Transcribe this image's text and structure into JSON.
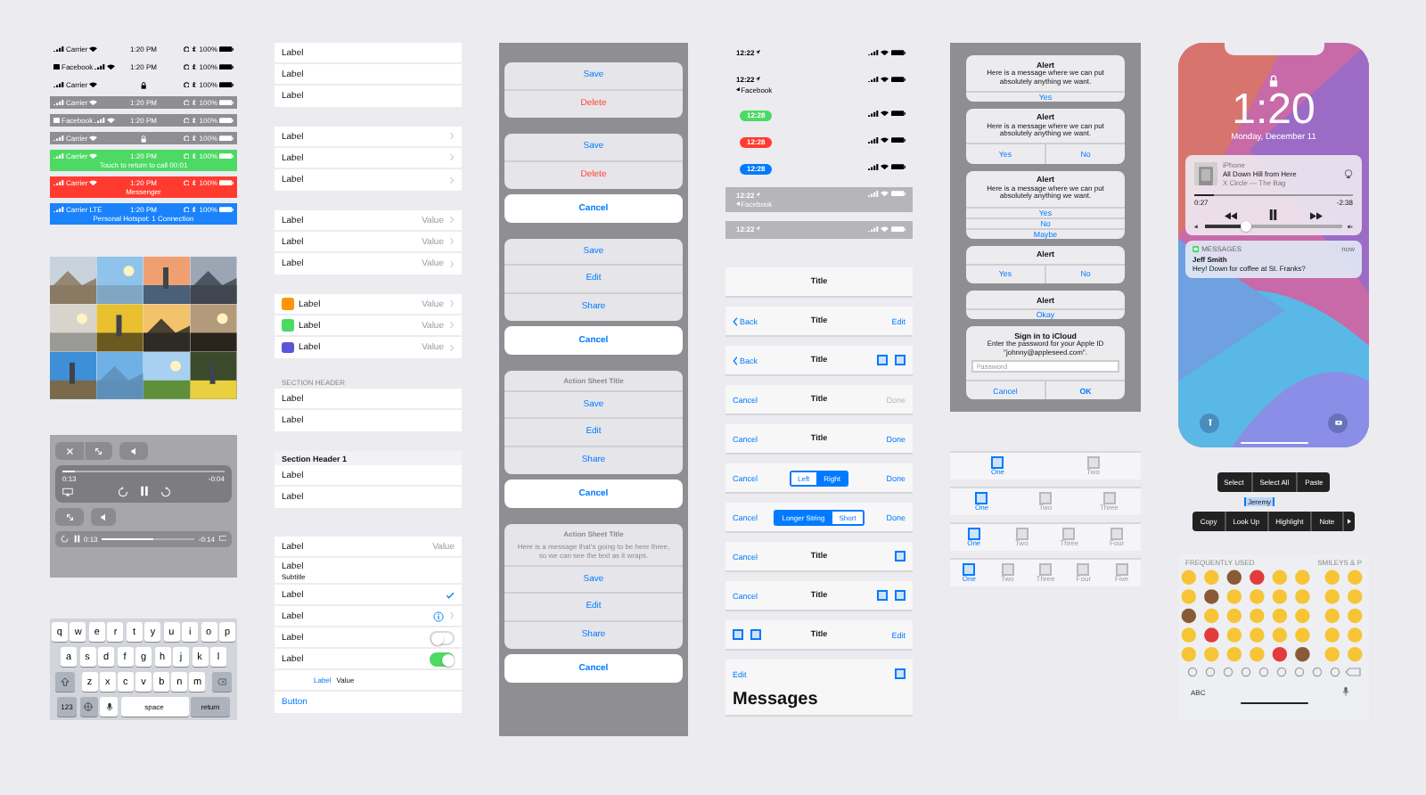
{
  "status_bars": [
    {
      "kind": "plain",
      "carrier": "Carrier",
      "time": "1:20 PM",
      "locked": false,
      "battery": "100%"
    },
    {
      "kind": "plain",
      "back_app": "Facebook",
      "time": "1:20 PM",
      "locked": false,
      "battery": "100%"
    },
    {
      "kind": "plain",
      "carrier": "Carrier",
      "locked": true,
      "battery": "100%"
    },
    {
      "kind": "gray",
      "carrier": "Carrier",
      "time": "1:20 PM",
      "locked": false,
      "battery": "100%"
    },
    {
      "kind": "gray",
      "back_app": "Facebook",
      "time": "1:20 PM",
      "locked": false,
      "battery": "100%"
    },
    {
      "kind": "gray",
      "carrier": "Carrier",
      "locked": true,
      "battery": "100%"
    },
    {
      "kind": "green",
      "carrier": "Carrier",
      "time": "1:20 PM",
      "locked": false,
      "battery": "100%",
      "banner": "Touch to return to call 00:01"
    },
    {
      "kind": "red",
      "carrier": "Carrier",
      "time": "1:20 PM",
      "locked": false,
      "battery": "100%",
      "banner": "Messenger"
    },
    {
      "kind": "blue",
      "carrier": "Carrier",
      "network": "LTE",
      "time": "1:20 PM",
      "locked": false,
      "battery": "100%",
      "banner": "Personal Hotspot: 1 Connection"
    }
  ],
  "video_controls": {
    "scrubber": {
      "elapsed": "0:13",
      "remaining": "-0:04",
      "level": 0.08
    },
    "mini_scrubber": {
      "elapsed": "0:13",
      "remaining": "-0:14",
      "level": 0.55
    }
  },
  "keyboard": {
    "rows": [
      [
        "q",
        "w",
        "e",
        "r",
        "t",
        "y",
        "u",
        "i",
        "o",
        "p"
      ],
      [
        "a",
        "s",
        "d",
        "f",
        "g",
        "h",
        "j",
        "k",
        "l"
      ],
      [
        "z",
        "x",
        "c",
        "v",
        "b",
        "n",
        "m"
      ]
    ],
    "numbers_key": "123",
    "space_key": "space",
    "return_key": "return"
  },
  "table_groups": [
    {
      "rows": [
        {
          "kind": "basic",
          "label": "Label"
        },
        {
          "kind": "basic",
          "label": "Label"
        },
        {
          "kind": "basic",
          "label": "Label"
        }
      ]
    },
    {
      "rows": [
        {
          "kind": "disclosure",
          "label": "Label"
        },
        {
          "kind": "disclosure",
          "label": "Label"
        },
        {
          "kind": "disclosure",
          "label": "Label"
        }
      ]
    },
    {
      "rows": [
        {
          "kind": "value",
          "label": "Label",
          "value": "Value"
        },
        {
          "kind": "value",
          "label": "Label",
          "value": "Value"
        },
        {
          "kind": "value",
          "label": "Label",
          "value": "Value"
        }
      ]
    },
    {
      "rows": [
        {
          "kind": "icon",
          "label": "Label",
          "value": "Value",
          "color": "#ff9500"
        },
        {
          "kind": "icon",
          "label": "Label",
          "value": "Value",
          "color": "#4cd964"
        },
        {
          "kind": "icon",
          "label": "Label",
          "value": "Value",
          "color": "#5856d6"
        }
      ]
    },
    {
      "header": {
        "kind": "caption",
        "text": "SECTION HEADER"
      },
      "rows": [
        {
          "kind": "basic",
          "label": "Label"
        },
        {
          "kind": "basic",
          "label": "Label"
        }
      ]
    },
    {
      "header": {
        "kind": "bar",
        "text": "Section Header 1"
      },
      "rows": [
        {
          "kind": "basic",
          "label": "Label"
        },
        {
          "kind": "basic",
          "label": "Label"
        }
      ]
    },
    {
      "rows": [
        {
          "kind": "detail",
          "label": "Label",
          "value": "Value"
        },
        {
          "kind": "subtitle",
          "label": "Label",
          "subtitle": "Subtitle"
        },
        {
          "kind": "check",
          "label": "Label"
        },
        {
          "kind": "info",
          "label": "Label"
        },
        {
          "kind": "switch",
          "label": "Label",
          "on": false
        },
        {
          "kind": "switch",
          "label": "Label",
          "on": true
        },
        {
          "kind": "inline",
          "label": "Label",
          "value": "Value"
        },
        {
          "kind": "button",
          "label": "Button"
        }
      ]
    }
  ],
  "action_sheets": [
    {
      "actions": [
        {
          "label": "Save",
          "kind": "default"
        },
        {
          "label": "Delete",
          "kind": "destructive"
        }
      ]
    },
    {
      "actions": [
        {
          "label": "Save",
          "kind": "default"
        },
        {
          "label": "Delete",
          "kind": "destructive"
        }
      ],
      "cancel": "Cancel"
    },
    {
      "actions": [
        {
          "label": "Save",
          "kind": "default"
        },
        {
          "label": "Edit",
          "kind": "default"
        },
        {
          "label": "Share",
          "kind": "default"
        }
      ],
      "cancel": "Cancel"
    },
    {
      "title": "Action Sheet Title",
      "actions": [
        {
          "label": "Save",
          "kind": "default"
        },
        {
          "label": "Edit",
          "kind": "default"
        },
        {
          "label": "Share",
          "kind": "default"
        }
      ],
      "cancel": "Cancel"
    },
    {
      "title": "Action Sheet Title",
      "message": "Here is a message that's going to be here three, so we can see the text as it wraps.",
      "actions": [
        {
          "label": "Save",
          "kind": "default"
        },
        {
          "label": "Edit",
          "kind": "default"
        },
        {
          "label": "Share",
          "kind": "default"
        }
      ],
      "cancel": "Cancel"
    }
  ],
  "phone_status_bars": [
    {
      "kind": "plain",
      "time": "12:22"
    },
    {
      "kind": "plain",
      "time": "12:22",
      "back": "Facebook"
    },
    {
      "kind": "green",
      "time": "12:28"
    },
    {
      "kind": "red",
      "time": "12:28"
    },
    {
      "kind": "blue",
      "time": "12:28"
    },
    {
      "kind": "gray",
      "time": "12:22",
      "back": "Facebook"
    },
    {
      "kind": "gray",
      "time": "12:22"
    }
  ],
  "nav_bars": [
    {
      "center": {
        "kind": "title",
        "text": "Title"
      }
    },
    {
      "left": [
        {
          "kind": "back",
          "text": "Back"
        }
      ],
      "center": {
        "kind": "title",
        "text": "Title"
      },
      "right": [
        {
          "kind": "text",
          "text": "Edit",
          "disabled": false
        }
      ]
    },
    {
      "left": [
        {
          "kind": "back",
          "text": "Back"
        }
      ],
      "center": {
        "kind": "title",
        "text": "Title"
      },
      "right": [
        {
          "kind": "icon"
        },
        {
          "kind": "icon"
        }
      ]
    },
    {
      "left": [
        {
          "kind": "text",
          "text": "Cancel",
          "disabled": false
        }
      ],
      "center": {
        "kind": "title",
        "text": "Title"
      },
      "right": [
        {
          "kind": "text",
          "text": "Done",
          "disabled": true
        }
      ]
    },
    {
      "left": [
        {
          "kind": "text",
          "text": "Cancel",
          "disabled": false
        }
      ],
      "center": {
        "kind": "title",
        "text": "Title"
      },
      "right": [
        {
          "kind": "text",
          "text": "Done",
          "disabled": false
        }
      ]
    },
    {
      "left": [
        {
          "kind": "text",
          "text": "Cancel",
          "disabled": false
        }
      ],
      "center": {
        "kind": "segments",
        "segments": [
          {
            "label": "Left",
            "selected": false
          },
          {
            "label": "Right",
            "selected": true
          }
        ]
      },
      "right": [
        {
          "kind": "text",
          "text": "Done",
          "disabled": false
        }
      ]
    },
    {
      "left": [
        {
          "kind": "text",
          "text": "Cancel",
          "disabled": false
        }
      ],
      "center": {
        "kind": "segments",
        "segments": [
          {
            "label": "Longer String",
            "selected": true
          },
          {
            "label": "Short",
            "selected": false
          }
        ]
      },
      "right": [
        {
          "kind": "text",
          "text": "Done",
          "disabled": false
        }
      ]
    },
    {
      "left": [
        {
          "kind": "text",
          "text": "Cancel",
          "disabled": false
        }
      ],
      "center": {
        "kind": "title",
        "text": "Title"
      },
      "right": [
        {
          "kind": "icon"
        }
      ]
    },
    {
      "left": [
        {
          "kind": "text",
          "text": "Cancel",
          "disabled": false
        }
      ],
      "center": {
        "kind": "title",
        "text": "Title"
      },
      "right": [
        {
          "kind": "icon"
        },
        {
          "kind": "icon"
        }
      ]
    },
    {
      "left": [
        {
          "kind": "icon"
        },
        {
          "kind": "icon"
        }
      ],
      "center": {
        "kind": "title",
        "text": "Title"
      },
      "right": [
        {
          "kind": "text",
          "text": "Edit",
          "disabled": false
        }
      ]
    },
    {
      "left": [
        {
          "kind": "text",
          "text": "Edit",
          "disabled": false
        }
      ],
      "right": [
        {
          "kind": "icon"
        }
      ],
      "large_title": "Messages"
    }
  ],
  "alerts": [
    {
      "kind": "stacked",
      "title": "Alert",
      "message": "Here is a message where we can put absolutely anything we want.",
      "actions": [
        {
          "label": "Yes",
          "kind": "default"
        }
      ]
    },
    {
      "kind": "row",
      "title": "Alert",
      "message": "Here is a message where we can put absolutely anything we want.",
      "actions": [
        {
          "label": "Yes",
          "kind": "default"
        },
        {
          "label": "No",
          "kind": "default"
        }
      ]
    },
    {
      "kind": "stacked",
      "title": "Alert",
      "message": "Here is a message where we can put absolutely anything we want.",
      "actions": [
        {
          "label": "Yes",
          "kind": "default"
        },
        {
          "label": "No",
          "kind": "default"
        },
        {
          "label": "Maybe",
          "kind": "default"
        }
      ]
    },
    {
      "kind": "row",
      "title": "Alert",
      "actions": [
        {
          "label": "Yes",
          "kind": "default"
        },
        {
          "label": "No",
          "kind": "default"
        }
      ]
    },
    {
      "kind": "stacked",
      "title": "Alert",
      "actions": [
        {
          "label": "Okay",
          "kind": "default"
        }
      ]
    },
    {
      "kind": "row",
      "title": "Sign in to iCloud",
      "message": "Enter the password for your Apple ID \"johnny@appleseed.com\".",
      "field": {
        "placeholder": "Password"
      },
      "actions": [
        {
          "label": "Cancel",
          "kind": "default"
        },
        {
          "label": "OK",
          "kind": "preferred"
        }
      ]
    }
  ],
  "tab_bars": [
    {
      "tabs": [
        {
          "label": "One",
          "selected": true
        },
        {
          "label": "Two",
          "selected": false
        }
      ]
    },
    {
      "tabs": [
        {
          "label": "One",
          "selected": true
        },
        {
          "label": "Two",
          "selected": false
        },
        {
          "label": "Three",
          "selected": false
        }
      ]
    },
    {
      "tabs": [
        {
          "label": "One",
          "selected": true
        },
        {
          "label": "Two",
          "selected": false
        },
        {
          "label": "Three",
          "selected": false
        },
        {
          "label": "Four",
          "selected": false
        }
      ]
    },
    {
      "tabs": [
        {
          "label": "One",
          "selected": true
        },
        {
          "label": "Two",
          "selected": false
        },
        {
          "label": "Three",
          "selected": false
        },
        {
          "label": "Four",
          "selected": false
        },
        {
          "label": "Five",
          "selected": false
        }
      ]
    }
  ],
  "lock_screen": {
    "time": "1:20",
    "date": "Monday, December 11",
    "now_playing": {
      "source": "iPhone",
      "title": "All Down Hill from Here",
      "artist": "X Circle — The Bag",
      "elapsed": "0:27",
      "remaining": "-2:38",
      "progress": {
        "level": 0.12
      },
      "volume": {
        "level": 0.3
      }
    },
    "notification": {
      "app": "MESSAGES",
      "time": "now",
      "sender": "Jeff Smith",
      "body": "Hey! Down for coffee at St. Franks?"
    }
  },
  "edit_menus": [
    {
      "items": [
        "Select",
        "Select All",
        "Paste"
      ],
      "more": false
    },
    {
      "items": [
        "Copy",
        "Look Up",
        "Highlight",
        "Note"
      ],
      "more": true
    }
  ],
  "selected_text": "Jeremy",
  "emoji_keyboard": {
    "sections": [
      "FREQUENTLY USED",
      "SMILEYS & P"
    ],
    "abc_key": "ABC"
  }
}
